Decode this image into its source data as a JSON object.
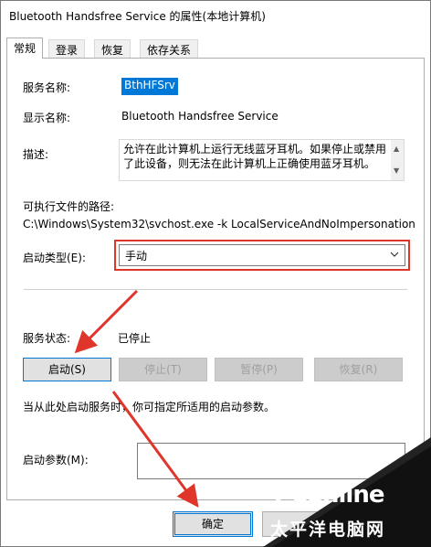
{
  "window": {
    "title": "Bluetooth Handsfree Service 的属性(本地计算机)"
  },
  "tabs": [
    {
      "label": "常规"
    },
    {
      "label": "登录"
    },
    {
      "label": "恢复"
    },
    {
      "label": "依存关系"
    }
  ],
  "general": {
    "service_name_label": "服务名称:",
    "service_name_value": "BthHFSrv",
    "display_name_label": "显示名称:",
    "display_name_value": "Bluetooth Handsfree Service",
    "description_label": "描述:",
    "description_value": "允许在此计算机上运行无线蓝牙耳机。如果停止或禁用了此设备，则无法在此计算机上正确使用蓝牙耳机。",
    "exe_path_label": "可执行文件的路径:",
    "exe_path_value": "C:\\Windows\\System32\\svchost.exe -k LocalServiceAndNoImpersonation",
    "startup_type_label": "启动类型(E):",
    "startup_type_value": "手动",
    "status_label": "服务状态:",
    "status_value": "已停止",
    "buttons": {
      "start": "启动(S)",
      "stop": "停止(T)",
      "pause": "暂停(P)",
      "resume": "恢复(R)"
    },
    "hint_text": "当从此处启动服务时，你可指定所适用的启动参数。",
    "params_label": "启动参数(M):"
  },
  "footer": {
    "ok": "确定"
  },
  "watermark": {
    "brand": "PConline",
    "brand_cn": "太平洋电脑网"
  },
  "colors": {
    "accent": "#0078d7",
    "annotation": "#e0352b"
  }
}
